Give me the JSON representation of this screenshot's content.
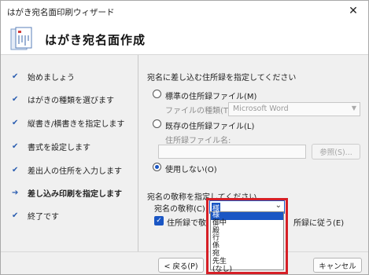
{
  "window": {
    "title": "はがき宛名面印刷ウィザード",
    "close_glyph": "✕"
  },
  "header": {
    "title": "はがき宛名面作成",
    "icon": "postcard-icon"
  },
  "steps": [
    {
      "label": "始めましょう",
      "mark": "✔"
    },
    {
      "label": "はがきの種類を選びます",
      "mark": "✔"
    },
    {
      "label": "縦書き/横書きを指定します",
      "mark": "✔"
    },
    {
      "label": "書式を設定します",
      "mark": "✔"
    },
    {
      "label": "差出人の住所を入力します",
      "mark": "✔"
    },
    {
      "label": "差し込み印刷を指定します",
      "mark": "➔"
    },
    {
      "label": "終了です",
      "mark": "✔"
    }
  ],
  "address_source": {
    "heading": "宛名に差し込む住所録を指定してください",
    "standard_option": "標準の住所録ファイル(M)",
    "file_type_label": "ファイルの種類(T):",
    "file_type_value": "Microsoft Word",
    "existing_option": "既存の住所録ファイル(L)",
    "address_file_label": "住所録ファイル名:",
    "browse_button": "参照(S)...",
    "none_option": "使用しない(O)",
    "selected": "none"
  },
  "honorific": {
    "heading": "宛名の敬称を指定してください",
    "label": "宛名の敬称(C):",
    "value": "様",
    "checkbox_label_left": "住所録で敬",
    "checkbox_label_right": "所録に従う(E)",
    "checkbox_checked": true,
    "options": [
      "様",
      "御中",
      "殿",
      "行",
      "係",
      "宛",
      "先生",
      "(なし)"
    ]
  },
  "footer": {
    "back": "< 戻る(P)",
    "cancel": "キャンセル"
  },
  "colors": {
    "accent": "#1a56c4",
    "highlight": "#d61f26"
  }
}
